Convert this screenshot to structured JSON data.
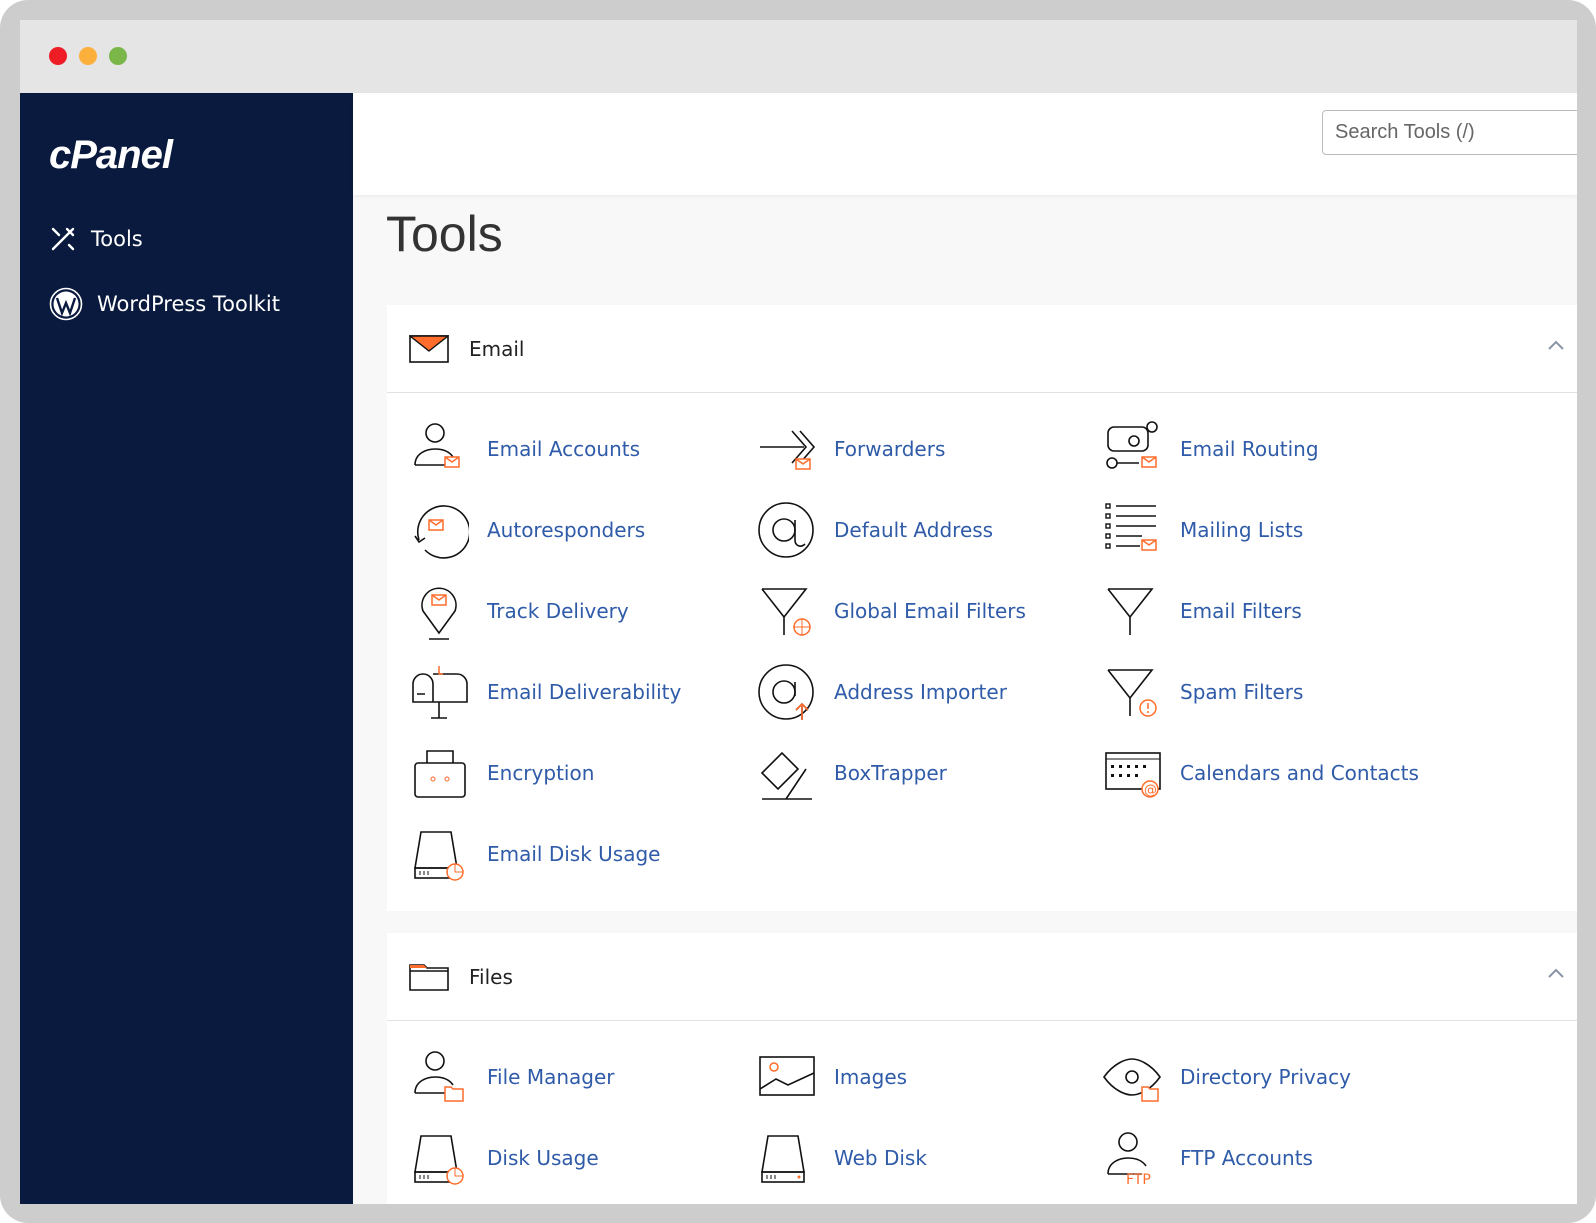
{
  "window": {
    "controls": {
      "close": "#ee1c24",
      "minimize": "#fbb03b",
      "zoom": "#7ab648"
    }
  },
  "sidebar": {
    "logo": "cPanel",
    "items": [
      {
        "label": "Tools",
        "icon": "tools-icon"
      },
      {
        "label": "WordPress Toolkit",
        "icon": "wordpress-icon"
      }
    ]
  },
  "search": {
    "placeholder": "Search Tools (/)",
    "value": ""
  },
  "page_title": "Tools",
  "colors": {
    "sidebar": "#0a1a3e",
    "link": "#2f5ba8",
    "accent": "#ff6c2c"
  },
  "sections": [
    {
      "title": "Email",
      "icon": "envelope-icon",
      "expanded": true,
      "items": [
        {
          "label": "Email Accounts",
          "icon": "user-mail"
        },
        {
          "label": "Forwarders",
          "icon": "forward"
        },
        {
          "label": "Email Routing",
          "icon": "routing"
        },
        {
          "label": "Autoresponders",
          "icon": "auto"
        },
        {
          "label": "Default Address",
          "icon": "at"
        },
        {
          "label": "Mailing Lists",
          "icon": "list"
        },
        {
          "label": "Track Delivery",
          "icon": "pin"
        },
        {
          "label": "Global Email Filters",
          "icon": "funnel-globe"
        },
        {
          "label": "Email Filters",
          "icon": "funnel"
        },
        {
          "label": "Email Deliverability",
          "icon": "mailbox"
        },
        {
          "label": "Address Importer",
          "icon": "at-up"
        },
        {
          "label": "Spam Filters",
          "icon": "funnel-warn"
        },
        {
          "label": "Encryption",
          "icon": "lockbox"
        },
        {
          "label": "BoxTrapper",
          "icon": "trap"
        },
        {
          "label": "Calendars and Contacts",
          "icon": "calendar"
        },
        {
          "label": "Email Disk Usage",
          "icon": "disk-pie"
        }
      ]
    },
    {
      "title": "Files",
      "icon": "folder-icon",
      "expanded": true,
      "items": [
        {
          "label": "File Manager",
          "icon": "user-folder"
        },
        {
          "label": "Images",
          "icon": "image"
        },
        {
          "label": "Directory Privacy",
          "icon": "eye-folder"
        },
        {
          "label": "Disk Usage",
          "icon": "disk-pie"
        },
        {
          "label": "Web Disk",
          "icon": "disk"
        },
        {
          "label": "FTP Accounts",
          "icon": "user-ftp"
        }
      ]
    }
  ]
}
